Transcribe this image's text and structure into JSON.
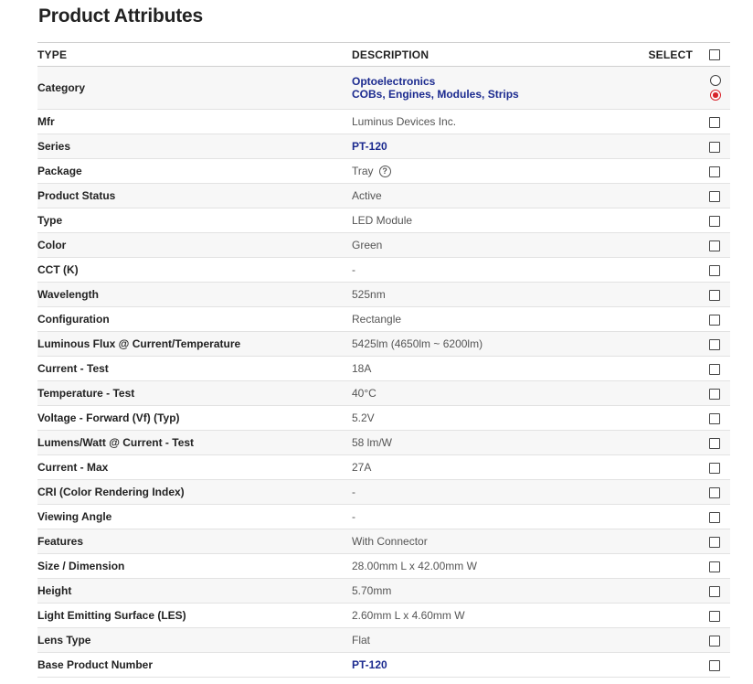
{
  "title": "Product Attributes",
  "header": {
    "type": "TYPE",
    "description": "DESCRIPTION",
    "select": "SELECT"
  },
  "category": {
    "label": "Category",
    "links": [
      "Optoelectronics",
      "COBs, Engines, Modules, Strips"
    ],
    "selected_index": 1
  },
  "rows": [
    {
      "type": "Mfr",
      "value": "Luminus Devices Inc.",
      "link": false
    },
    {
      "type": "Series",
      "value": "PT-120",
      "link": true
    },
    {
      "type": "Package",
      "value": "Tray",
      "link": false,
      "help": true,
      "help_icon": "question-circle-icon"
    },
    {
      "type": "Product Status",
      "value": "Active",
      "link": false
    },
    {
      "type": "Type",
      "value": "LED Module",
      "link": false
    },
    {
      "type": "Color",
      "value": "Green",
      "link": false
    },
    {
      "type": "CCT (K)",
      "value": "-",
      "link": false
    },
    {
      "type": "Wavelength",
      "value": "525nm",
      "link": false
    },
    {
      "type": "Configuration",
      "value": "Rectangle",
      "link": false
    },
    {
      "type": "Luminous Flux @ Current/Temperature",
      "value": "5425lm (4650lm ~ 6200lm)",
      "link": false
    },
    {
      "type": "Current - Test",
      "value": "18A",
      "link": false
    },
    {
      "type": "Temperature - Test",
      "value": "40°C",
      "link": false
    },
    {
      "type": "Voltage - Forward (Vf) (Typ)",
      "value": "5.2V",
      "link": false
    },
    {
      "type": "Lumens/Watt @ Current - Test",
      "value": "58 lm/W",
      "link": false
    },
    {
      "type": "Current - Max",
      "value": "27A",
      "link": false
    },
    {
      "type": "CRI (Color Rendering Index)",
      "value": "-",
      "link": false
    },
    {
      "type": "Viewing Angle",
      "value": "-",
      "link": false
    },
    {
      "type": "Features",
      "value": "With Connector",
      "link": false
    },
    {
      "type": "Size / Dimension",
      "value": "28.00mm L x 42.00mm W",
      "link": false
    },
    {
      "type": "Height",
      "value": "5.70mm",
      "link": false
    },
    {
      "type": "Light Emitting Surface (LES)",
      "value": "2.60mm L x 4.60mm W",
      "link": false
    },
    {
      "type": "Lens Type",
      "value": "Flat",
      "link": false
    },
    {
      "type": "Base Product Number",
      "value": "PT-120",
      "link": true
    }
  ],
  "colors": {
    "link": "#1b2a8f",
    "radio_selected": "#d8232a",
    "stripe": "#f7f7f7"
  }
}
